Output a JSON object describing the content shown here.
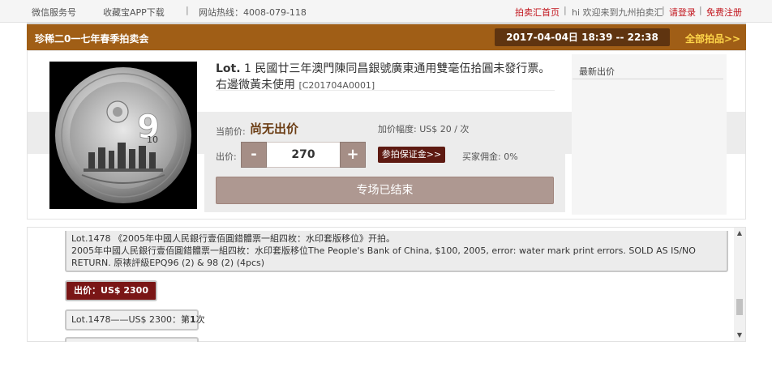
{
  "topbar": {
    "wechat": "微信服务号",
    "app": "收藏宝APP下载",
    "hotline": "网站热线：4008-079-118",
    "home": "拍卖汇首页",
    "welcome": "hi 欢迎来到九州拍卖汇",
    "login": "请登录",
    "register": "免费注册"
  },
  "banner": {
    "title": "珍稀二0一七年春季拍卖会",
    "time": "2017-04-04日 18:39 -- 22:38",
    "all_lots": "全部拍品>>"
  },
  "lot": {
    "prefix": "Lot.",
    "number": "1",
    "title": "民國廿三年澳門陳同昌銀號廣東通用雙毫伍拾圓未發行票。右邊微黃未使用",
    "code": "[C201704A0001]",
    "image_alt": "coin"
  },
  "bid": {
    "current_label": "当前价:",
    "current_value": "尚无出价",
    "increment_label": "加价幅度: US$ 20 / 次",
    "bid_label": "出价:",
    "minus": "-",
    "amount": "270",
    "plus": "+",
    "deposit_button": "参拍保证金>>",
    "commission": "买家佣金: 0%",
    "ended_button": "专场已结束"
  },
  "latest": {
    "title": "最新出价"
  },
  "log": {
    "message": "Lot.1478 《2005年中國人民銀行壹佰圓錯體票一組四枚：水印套版移位》开拍。\n2005年中國人民銀行壹佰圓錯體票一組四枚：水印套版移位The People's Bank of China, $100, 2005, error: water mark print errors. SOLD AS IS/NO RETURN. 原裱評級EPQ96 (2) & 98 (2) (4pcs)",
    "bid_pill": "出价：US$ 2300",
    "entry_prefix": "Lot.1478——US$ 2300：第",
    "entry_count": "1",
    "entry_suffix": "次"
  },
  "colors": {
    "banner": "#a05e16",
    "banner_time": "#5f3410",
    "accent_red": "#c2151d",
    "bid_pill": "#7a1616",
    "deposit": "#5e1a12"
  }
}
